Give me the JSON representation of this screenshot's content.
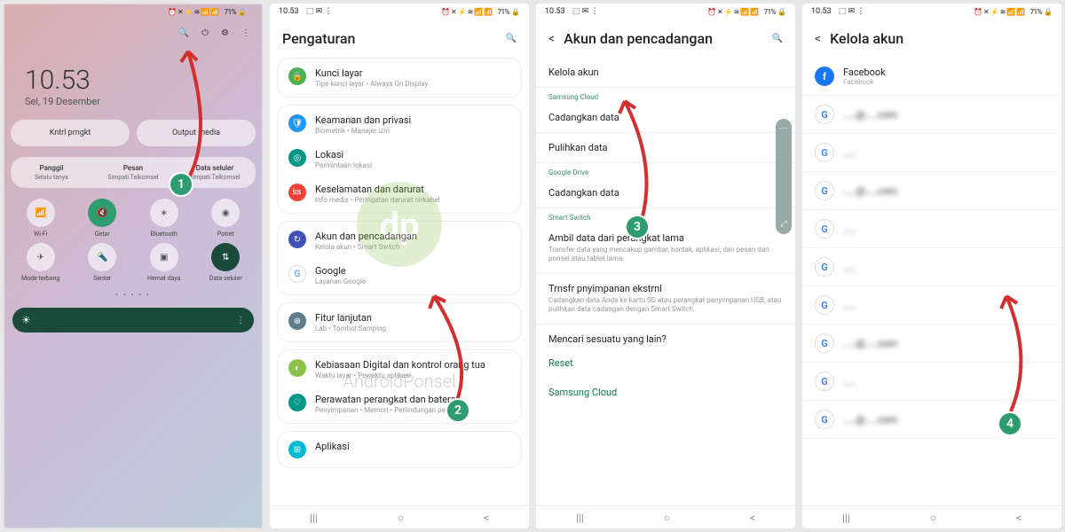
{
  "status": {
    "time": "10.53",
    "icons_left": "⬚ ✉ ⋮",
    "icons_right": "⏰ ✕ ⚡ ≋ 📶 📶",
    "battery": "71%"
  },
  "watermark": "AndroidPonsel",
  "p1": {
    "clock": "10.53",
    "date": "Sel, 19 Desember",
    "btn_left": "Kntrl prngkt",
    "btn_right": "Output media",
    "triple": [
      {
        "t": "Panggil",
        "s": "Selalu tanya"
      },
      {
        "t": "Pesan",
        "s": "Simpati Telkomsel"
      },
      {
        "t": "Data seluler",
        "s": "Simpati Telkomsel"
      }
    ],
    "qs": [
      {
        "label": "Wi-Fi",
        "glyph": "📶"
      },
      {
        "label": "Getar",
        "glyph": "🔇",
        "active": true
      },
      {
        "label": "Bluetooth",
        "glyph": "∗"
      },
      {
        "label": "Potret",
        "glyph": "◉"
      },
      {
        "label": "Mode terbang",
        "glyph": "✈"
      },
      {
        "label": "Senter",
        "glyph": "🔦"
      },
      {
        "label": "Hemat daya",
        "glyph": "▣"
      },
      {
        "label": "Data seluler",
        "glyph": "⇅",
        "dark": true
      }
    ],
    "dots": "• • • • •"
  },
  "p2": {
    "title": "Pengaturan",
    "items": [
      {
        "ico": "c-grn",
        "g": "🔒",
        "t": "Kunci layar",
        "s": "Tipe kunci layar • Always On Display"
      },
      {
        "ico": "c-blu",
        "g": "🛡",
        "t": "Keamanan dan privasi",
        "s": "Biometrik • Manajer izin"
      },
      {
        "ico": "c-teal",
        "g": "◎",
        "t": "Lokasi",
        "s": "Permintaan lokasi"
      },
      {
        "ico": "c-red",
        "g": "🆘",
        "t": "Keselamatan dan darurat",
        "s": "Info medis • Peringatan darurat nirkabel"
      },
      {
        "ico": "c-nav",
        "g": "↻",
        "t": "Akun dan pencadangan",
        "s": "Kelola akun • Smart Switch"
      },
      {
        "ico": "c-ggl",
        "g": "G",
        "t": "Google",
        "s": "Layanan Google"
      },
      {
        "ico": "c-gry",
        "g": "⊕",
        "t": "Fitur lanjutan",
        "s": "Lab • Tombol Samping"
      },
      {
        "ico": "c-lim",
        "g": "◐",
        "t": "Kebiasaan Digital dan kontrol orang tua",
        "s": "Waktu layar • Pewaktu aplikasi"
      },
      {
        "ico": "c-teal",
        "g": "♡",
        "t": "Perawatan perangkat dan baterai",
        "s": "Penyimpanan • Memori • Perlindungan perangkat"
      },
      {
        "ico": "c-cyn",
        "g": "⊞",
        "t": "Aplikasi",
        "s": ""
      }
    ]
  },
  "p3": {
    "title": "Akun dan pencadangan",
    "rows": {
      "kelola": "Kelola akun",
      "sec_samsung": "Samsung Cloud",
      "cadangkan": "Cadangkan data",
      "pulihkan": "Pulihkan data",
      "sec_drive": "Google Drive",
      "cadangkan2": "Cadangkan data",
      "sec_smart": "Smart Switch",
      "ambil_t": "Ambil data dari perangkat lama",
      "ambil_s": "Transfer data yang mencakup gambar, kontak, aplikasi, dan pesan dari ponsel atau tablet lama.",
      "trnsfr_t": "Trnsfr pnyimpanan ekstrnl",
      "trnsfr_s": "Cadangkan data Anda ke kartu SD atau perangkat penyimpanan USB, atau pulihkan data cadangan dengan Smart Switch.",
      "mencari": "Mencari sesuatu yang lain?",
      "reset": "Reset",
      "cloud": "Samsung Cloud"
    }
  },
  "p4": {
    "title": "Kelola akun",
    "accounts": [
      {
        "icon_bg": "#1877f2",
        "icon_txt": "f",
        "t": "Facebook",
        "s": "Facebook"
      },
      {
        "icon_bg": "#fff",
        "icon_txt": "G",
        "t": "……@……com",
        "s": "",
        "blur": true
      },
      {
        "icon_bg": "#fff",
        "icon_txt": "G",
        "t": "……",
        "s": "",
        "blur": true
      },
      {
        "icon_bg": "#fff",
        "icon_txt": "G",
        "t": "……@……com",
        "s": "",
        "blur": true
      },
      {
        "icon_bg": "#fff",
        "icon_txt": "G",
        "t": "……",
        "s": "",
        "blur": true
      },
      {
        "icon_bg": "#fff",
        "icon_txt": "G",
        "t": "……",
        "s": "",
        "blur": true
      },
      {
        "icon_bg": "#fff",
        "icon_txt": "G",
        "t": "……",
        "s": "",
        "blur": true
      },
      {
        "icon_bg": "#fff",
        "icon_txt": "G",
        "t": "……@……com",
        "s": "",
        "blur": true
      },
      {
        "icon_bg": "#fff",
        "icon_txt": "G",
        "t": "……",
        "s": "",
        "blur": true
      },
      {
        "icon_bg": "#fff",
        "icon_txt": "G",
        "t": "……@……com",
        "s": "",
        "blur": true
      }
    ]
  },
  "badges": {
    "1": "1",
    "2": "2",
    "3": "3",
    "4": "4"
  }
}
